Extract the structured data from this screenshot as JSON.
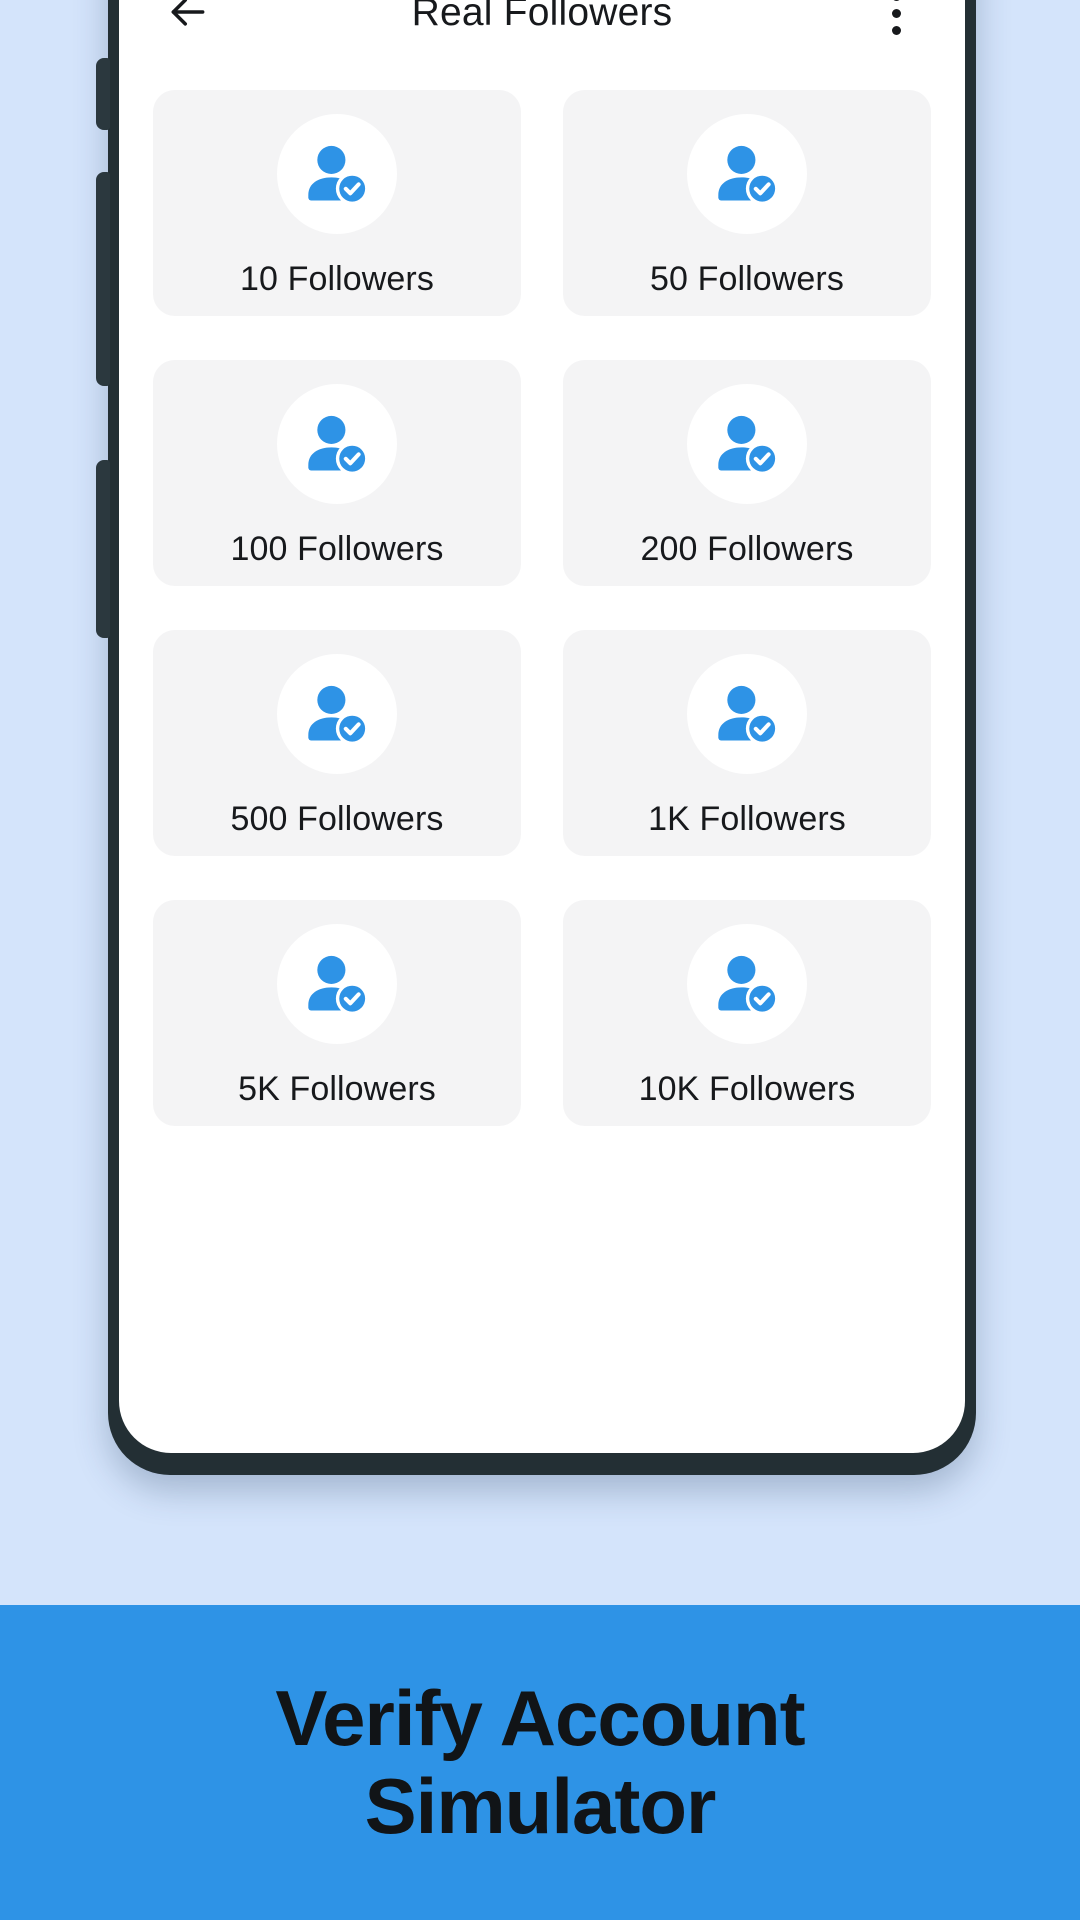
{
  "app": {
    "title": "Real Followers",
    "back_icon": "arrow-left-icon",
    "menu_icon": "more-vertical-icon"
  },
  "packages": [
    {
      "label": "10 Followers",
      "icon": "verified-user-icon"
    },
    {
      "label": "50 Followers",
      "icon": "verified-user-icon"
    },
    {
      "label": "100 Followers",
      "icon": "verified-user-icon"
    },
    {
      "label": "200 Followers",
      "icon": "verified-user-icon"
    },
    {
      "label": "500 Followers",
      "icon": "verified-user-icon"
    },
    {
      "label": "1K Followers",
      "icon": "verified-user-icon"
    },
    {
      "label": "5K Followers",
      "icon": "verified-user-icon"
    },
    {
      "label": "10K Followers",
      "icon": "verified-user-icon"
    }
  ],
  "promo": {
    "line1": "Verify Account",
    "line2": "Simulator"
  },
  "colors": {
    "page_background": "#d4e4fb",
    "promo_background": "#2e93e6",
    "promo_text": "#111417",
    "screen_background": "#ffffff",
    "card_background": "#f4f4f5",
    "accent_blue": "#2e93e6",
    "text_primary": "#17191c",
    "device_frame": "#232f34"
  }
}
